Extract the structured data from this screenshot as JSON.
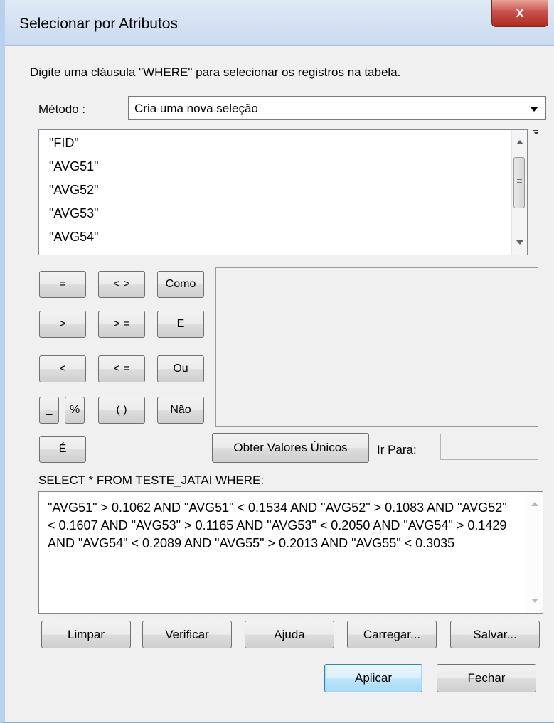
{
  "window": {
    "title": "Selecionar por Atributos",
    "close_label": "x"
  },
  "instructions": "Digite uma cláusula \"WHERE\" para selecionar os registros na tabela.",
  "method": {
    "label": "Método :",
    "selected": "Cria uma nova seleção"
  },
  "fields": [
    "\"FID\"",
    "\"AVG51\"",
    "\"AVG52\"",
    "\"AVG53\"",
    "\"AVG54\""
  ],
  "operators": {
    "eq": "=",
    "neq": "< >",
    "like": "Como",
    "gt": ">",
    "gte": "> =",
    "and": "E",
    "lt": "<",
    "lte": "< =",
    "or": "Ou",
    "underscore": "_",
    "percent": "%",
    "parens": "( )",
    "not": "Não",
    "is": "É"
  },
  "unique_values_button": "Obter Valores Únicos",
  "goto_label": "Ir Para:",
  "goto_value": "",
  "sql_prefix": "SELECT * FROM TESTE_JATAI WHERE:",
  "sql_expression": "\"AVG51\" > 0.1062 AND \"AVG51\" < 0.1534 AND \"AVG52\" > 0.1083 AND \"AVG52\" < 0.1607 AND \"AVG53\" > 0.1165 AND \"AVG53\" < 0.2050 AND \"AVG54\" > 0.1429 AND \"AVG54\" < 0.2089 AND \"AVG55\" > 0.2013 AND \"AVG55\" < 0.3035",
  "bottom_buttons": {
    "clear": "Limpar",
    "verify": "Verificar",
    "help": "Ajuda",
    "load": "Carregar...",
    "save": "Salvar..."
  },
  "apply_label": "Aplicar",
  "close_label": "Fechar",
  "colors": {
    "titlebar": "#c9dbef",
    "close_button": "#c75050",
    "default_button_border": "#3c7fb1"
  }
}
